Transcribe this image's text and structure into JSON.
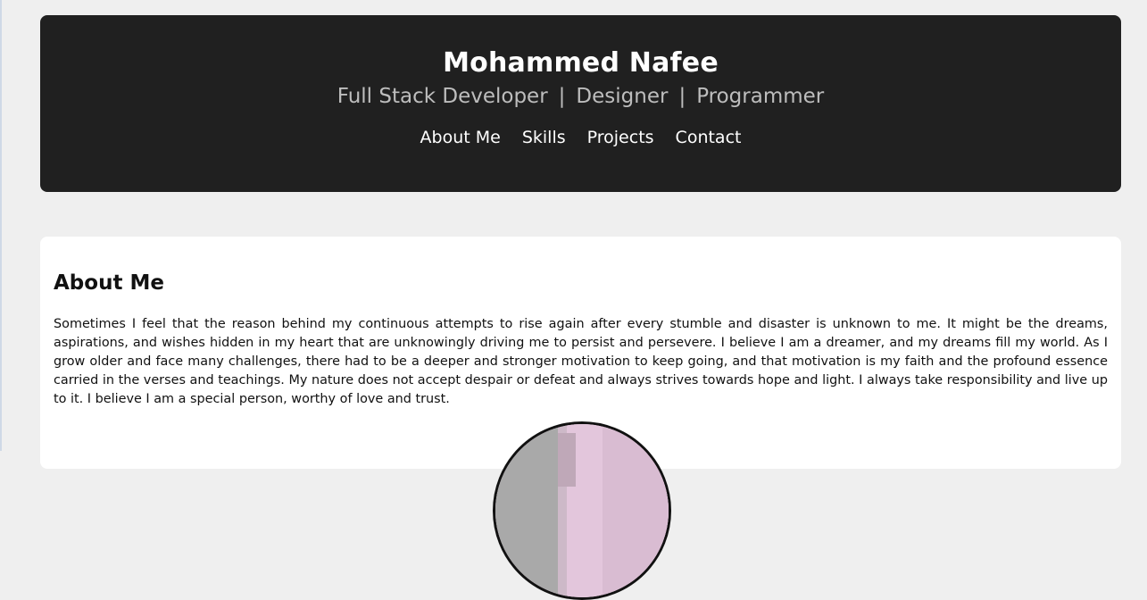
{
  "header": {
    "name": "Mohammed Nafee",
    "roles": [
      "Full Stack Developer",
      "Designer",
      "Programmer"
    ],
    "separator": "|",
    "nav": [
      {
        "label": "About Me"
      },
      {
        "label": "Skills"
      },
      {
        "label": "Projects"
      },
      {
        "label": "Contact"
      }
    ]
  },
  "about": {
    "title": "About Me",
    "body": "Sometimes I feel that the reason behind my continuous attempts to rise again after every stumble and disaster is unknown to me. It might be the dreams, aspirations, and wishes hidden in my heart that are unknowingly driving me to persist and persevere. I believe I am a dreamer, and my dreams fill my world. As I grow older and face many challenges, there had to be a deeper and stronger motivation to keep going, and that motivation is my faith and the profound essence carried in the verses and teachings. My nature does not accept despair or defeat and always strives towards hope and light. I always take responsibility and live up to it. I believe I am a special person, worthy of love and trust."
  },
  "colors": {
    "page_bg": "#efefef",
    "header_bg": "#202020",
    "tagline": "#bdbdbd",
    "card_bg": "#ffffff",
    "avatar_tone": "#d6c7d2"
  },
  "icons": {
    "profile_photo": "profile-photo"
  }
}
